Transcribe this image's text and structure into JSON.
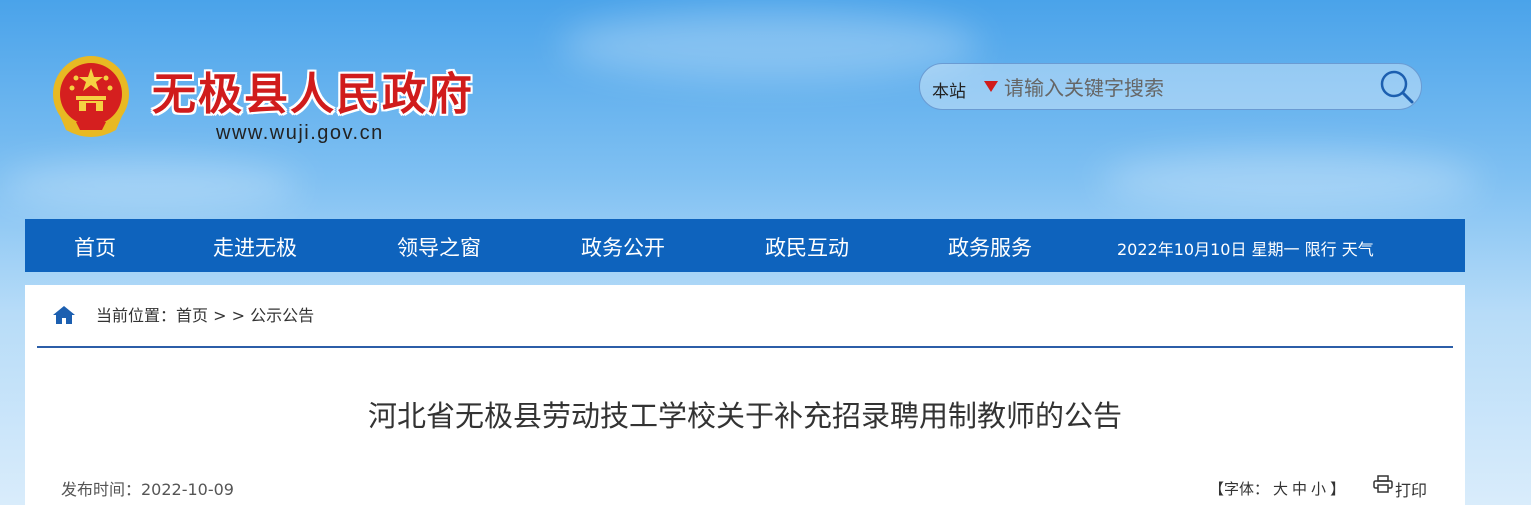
{
  "header": {
    "site_title": "无极县人民政府",
    "site_url": "www.wuji.gov.cn"
  },
  "search": {
    "scope": "本站",
    "placeholder": "请输入关键字搜索"
  },
  "nav": {
    "items": [
      "首页",
      "走进无极",
      "领导之窗",
      "政务公开",
      "政民互动",
      "政务服务"
    ],
    "date_info": "2022年10月10日 星期一  限行  天气"
  },
  "breadcrumb": {
    "text": "当前位置：首页 > > 公示公告"
  },
  "article": {
    "title": "河北省无极县劳动技工学校关于补充招录聘用制教师的公告",
    "publish_time": "发布时间：2022-10-09",
    "font_size": {
      "open": "【字体：",
      "large": "大",
      "medium": "中",
      "small": "小",
      "close": "】"
    },
    "print_label": "打印"
  },
  "colors": {
    "nav_bg": "#0e63bd",
    "title_red": "#d01c1c",
    "divider": "#2c5ea8"
  }
}
